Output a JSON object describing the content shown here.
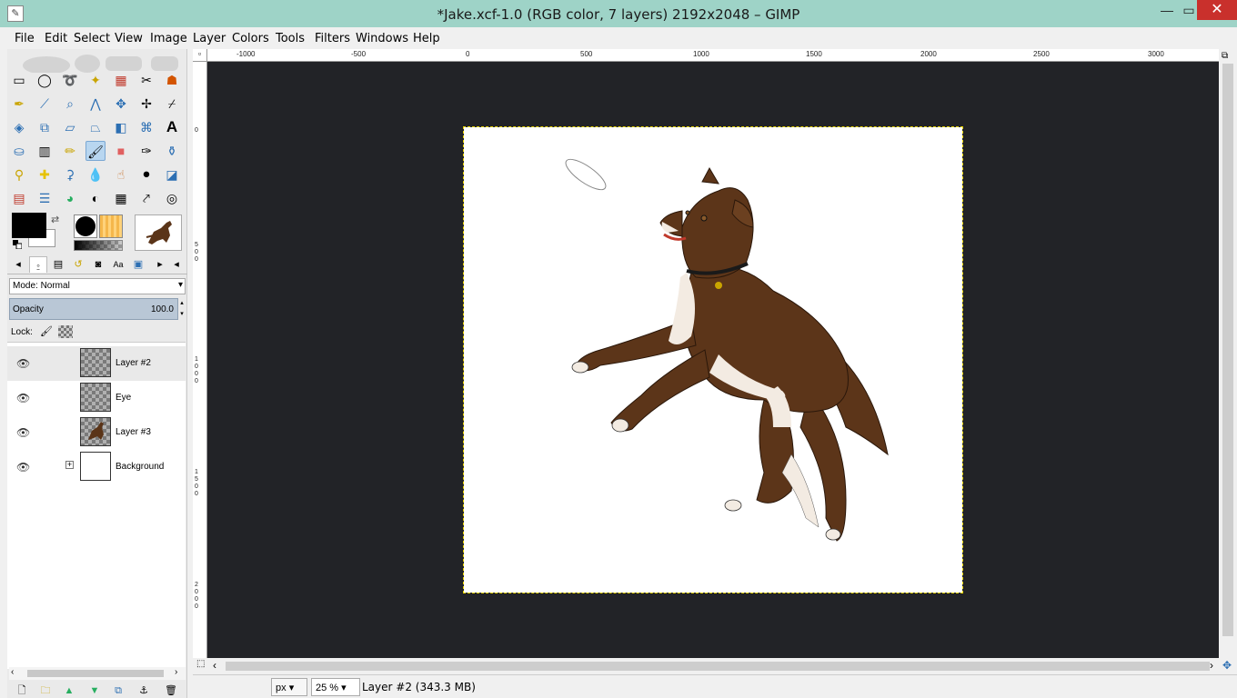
{
  "window": {
    "title": "*Jake.xcf-1.0 (RGB color, 7 layers) 2192x2048 – GIMP",
    "minimize": "—",
    "maximize": "▭",
    "close": "✕"
  },
  "menu": [
    "File",
    "Edit",
    "Select",
    "View",
    "Image",
    "Layer",
    "Colors",
    "Tools",
    "Filters",
    "Windows",
    "Help"
  ],
  "toolbox": {
    "active_tool": "paintbrush-icon",
    "foreground_color": "#000000",
    "background_color": "#ffffff"
  },
  "layers_panel": {
    "mode_label": "Mode: Normal",
    "opacity_label": "Opacity",
    "opacity_value": "100.0",
    "lock_label": "Lock:",
    "layers": [
      {
        "name": "Layer #2",
        "selected": true
      },
      {
        "name": "Eye",
        "selected": false
      },
      {
        "name": "Layer #3",
        "selected": false
      },
      {
        "name": "Background",
        "selected": false,
        "group": true
      }
    ]
  },
  "ruler": {
    "top_labels": [
      "-1000",
      "-500",
      "0",
      "500",
      "1000",
      "1500",
      "2000",
      "2500",
      "3000"
    ],
    "left_labels": [
      "0",
      "500",
      "1000",
      "1500",
      "2000"
    ]
  },
  "status": {
    "unit": "px",
    "zoom": "25 %",
    "message": "Layer #2 (343.3 MB)"
  }
}
